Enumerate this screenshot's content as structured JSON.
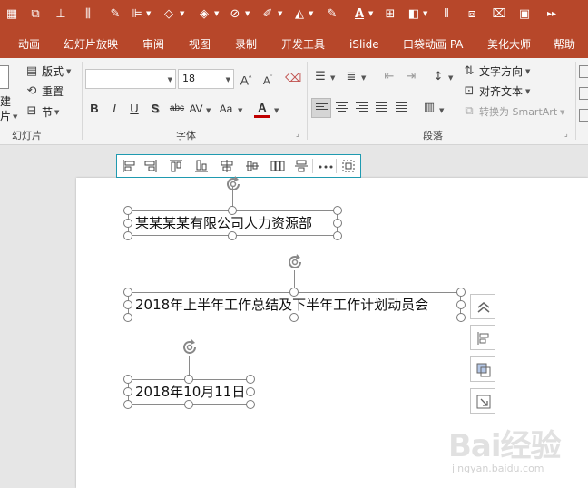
{
  "colors": {
    "accent": "#b7472a",
    "ribbon_bg": "#f3f3f3",
    "workspace_bg": "#e6e6e6",
    "selection_border": "#1f9ab0"
  },
  "quick_access": {
    "icons": [
      "table-grid-icon",
      "group-icon",
      "align-center-icon",
      "distribute-icon",
      "eyedropper-icon",
      "align-left-icon",
      "shape-outline-icon",
      "fill-color-icon",
      "shape-effects-icon",
      "pen-color-icon",
      "text-highlight-icon",
      "eyedropper-icon",
      "font-color-icon",
      "grid-icon",
      "color-palette-icon",
      "distribute-horizontal-icon",
      "copy-format-icon",
      "image-icon",
      "image-replace-icon",
      "more-icon"
    ]
  },
  "tabs": [
    {
      "label": "动画"
    },
    {
      "label": "幻灯片放映"
    },
    {
      "label": "审阅"
    },
    {
      "label": "视图"
    },
    {
      "label": "录制"
    },
    {
      "label": "开发工具"
    },
    {
      "label": "iSlide"
    },
    {
      "label": "口袋动画 PA"
    },
    {
      "label": "美化大师"
    },
    {
      "label": "帮助"
    }
  ],
  "ribbon": {
    "slides": {
      "new_slide_label_top": "建",
      "new_slide_label_bottom": "片",
      "layout_label": "版式",
      "reset_label": "重置",
      "section_label": "节",
      "group_label": "幻灯片"
    },
    "font": {
      "font_name": "",
      "font_size": "18",
      "group_label": "字体",
      "bold": "B",
      "italic": "I",
      "underline": "U",
      "shadow": "S",
      "strikethrough": "abc",
      "char_spacing": "AV",
      "change_case": "Aa",
      "font_color": "A"
    },
    "paragraph": {
      "text_direction_label": "文字方向",
      "align_text_label": "对齐文本",
      "convert_smartart_label": "转换为 SmartArt",
      "group_label": "段落"
    }
  },
  "slide": {
    "textboxes": [
      {
        "text": "某某某某有限公司人力资源部"
      },
      {
        "text": "2018年上半年工作总结及下半年工作计划动员会"
      },
      {
        "text": "2018年10月11日"
      }
    ]
  },
  "watermark": {
    "logo": "Bai经验",
    "url": "jingyan.baidu.com"
  }
}
